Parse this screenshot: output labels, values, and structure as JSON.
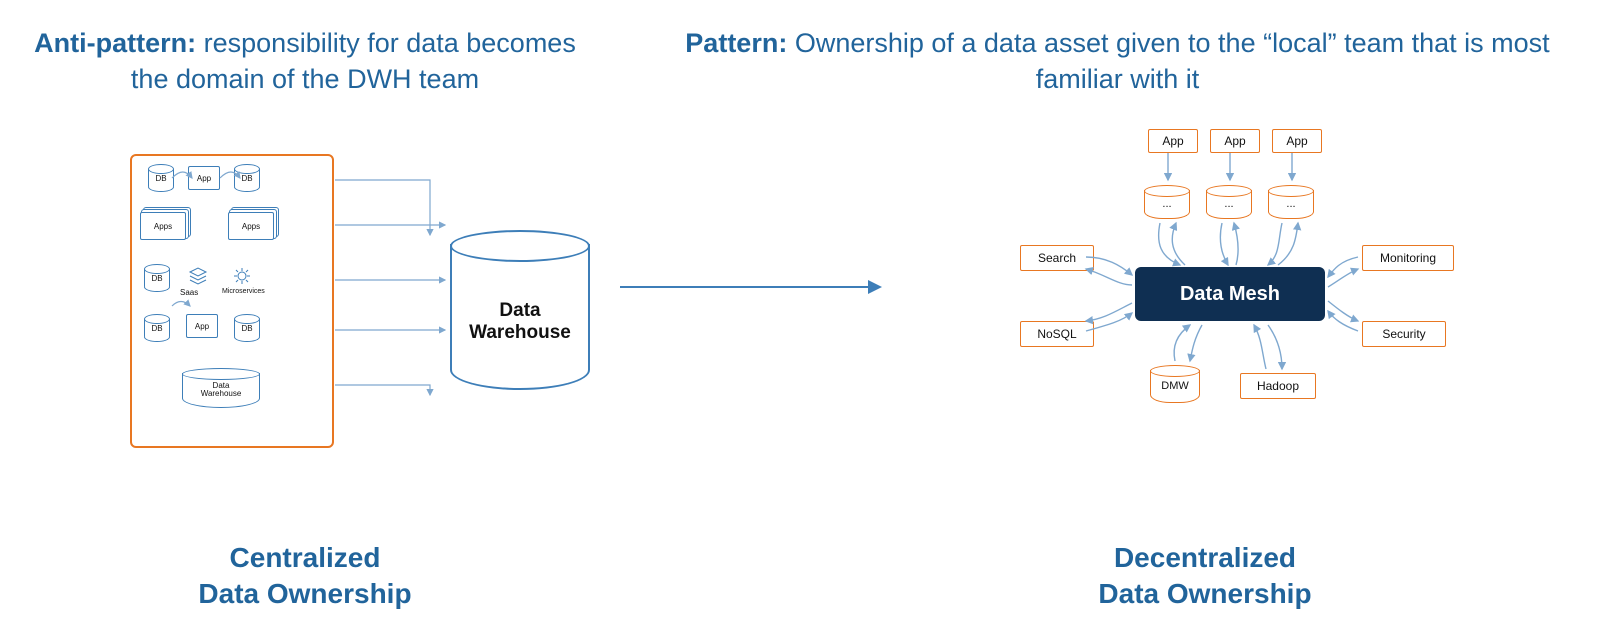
{
  "left": {
    "heading_bold": "Anti-pattern:",
    "heading_rest": " responsibility for data becomes the domain of the DWH team",
    "caption_line1": "Centralized",
    "caption_line2": "Data Ownership",
    "warehouse_label_line1": "Data",
    "warehouse_label_line2": "Warehouse",
    "nodes": {
      "db1": "DB",
      "db2": "DB",
      "db3": "DB",
      "db4": "DB",
      "db5": "DB",
      "apps": "Apps",
      "apps2": "Apps",
      "app1": "App",
      "app2": "App",
      "saas": "Saas",
      "micro": "Microservices",
      "dwh_small_l1": "Data",
      "dwh_small_l2": "Warehouse"
    }
  },
  "right": {
    "heading_bold": "Pattern:",
    "heading_rest": " Ownership of a data asset given to the “local” team that is most familiar with it",
    "caption_line1": "Decentralized",
    "caption_line2": "Data Ownership",
    "mesh_label": "Data Mesh",
    "nodes": {
      "app_a": "App",
      "app_b": "App",
      "app_c": "App",
      "dots_a": "...",
      "dots_b": "...",
      "dots_c": "...",
      "search": "Search",
      "monitoring": "Monitoring",
      "nosql": "NoSQL",
      "security": "Security",
      "dmw": "DMW",
      "hadoop": "Hadoop"
    }
  }
}
